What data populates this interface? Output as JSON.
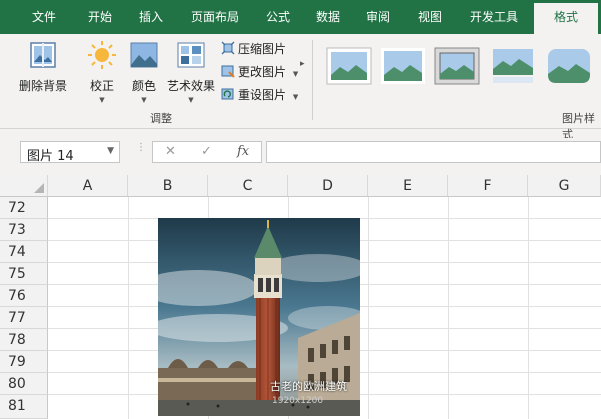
{
  "tabs": {
    "file": "文件",
    "home": "开始",
    "insert": "插入",
    "page_layout": "页面布局",
    "formulas": "公式",
    "data": "数据",
    "review": "审阅",
    "view": "视图",
    "developer": "开发工具",
    "format": "格式"
  },
  "ribbon": {
    "remove_bg": "删除背景",
    "corrections": "校正",
    "color": "颜色",
    "artistic": "艺术效果",
    "compress": "压缩图片",
    "change": "更改图片",
    "reset": "重设图片",
    "adjust_group": "调整",
    "styles_group": "图片样式"
  },
  "formula_bar": {
    "name_box": "图片 14",
    "cancel": "✕",
    "enter": "✓",
    "fx": "fx",
    "formula": ""
  },
  "grid": {
    "columns": [
      "A",
      "B",
      "C",
      "D",
      "E",
      "F",
      "G"
    ],
    "rows": [
      "72",
      "73",
      "74",
      "75",
      "76",
      "77",
      "78",
      "79",
      "80",
      "81"
    ]
  },
  "picture": {
    "caption": "古老的欧洲建筑",
    "dimensions": "1920x1200"
  },
  "colors": {
    "accent": "#217346"
  }
}
